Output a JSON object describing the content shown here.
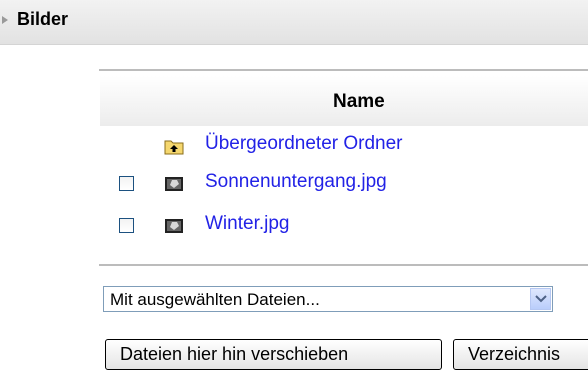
{
  "section": {
    "title": "Bilder"
  },
  "file_table": {
    "column_name": "Name",
    "rows": [
      {
        "label": "Übergeordneter Ordner",
        "icon": "parent-folder-icon",
        "has_checkbox": false
      },
      {
        "label": "Sonnenuntergang.jpg",
        "icon": "image-file-icon",
        "has_checkbox": true
      },
      {
        "label": "Winter.jpg",
        "icon": "image-file-icon",
        "has_checkbox": true
      }
    ]
  },
  "actions": {
    "select_value": "Mit ausgewählten Dateien...",
    "move_button_label": "Dateien hier hin verschieben",
    "directory_button_label": "Verzeichnis"
  },
  "colors": {
    "link": "#2222e6",
    "header_bg": "#e8e8e8",
    "rule": "#bcbcbc"
  }
}
